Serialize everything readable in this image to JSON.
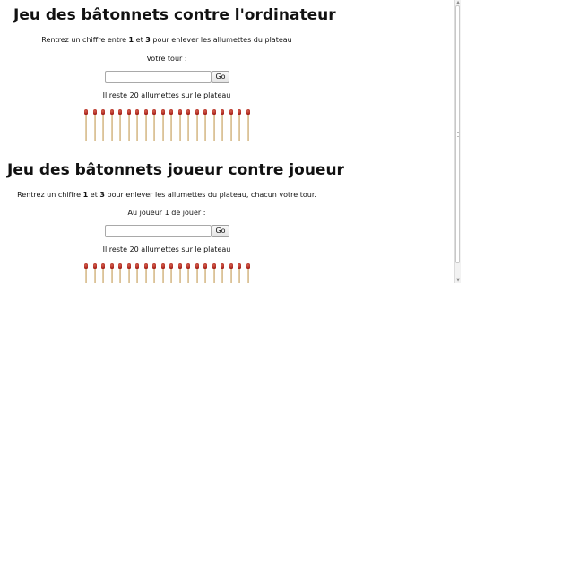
{
  "games": [
    {
      "title": "Jeu des bâtonnets contre l'ordinateur",
      "instruction": {
        "before": "Rentrez un chiffre entre ",
        "min": "1",
        "between": " et ",
        "max": "3",
        "after": " pour enlever les allumettes du plateau"
      },
      "turn_text": "Votre tour :",
      "input": {
        "value": "",
        "placeholder": ""
      },
      "go_label": "Go",
      "remaining_text": "Il reste 20 allumettes sur le plateau",
      "matches_count": 20
    },
    {
      "title": "Jeu des bâtonnets joueur contre joueur",
      "instruction": {
        "before": "Rentrez un chiffre ",
        "min": "1",
        "between": " et ",
        "max": "3",
        "after": " pour enlever les allumettes du plateau, chacun votre tour."
      },
      "turn_text": "Au joueur 1 de jouer :",
      "input": {
        "value": "",
        "placeholder": ""
      },
      "go_label": "Go",
      "remaining_text": "Il reste 20 allumettes sur le plateau",
      "matches_count": 20
    }
  ],
  "colors": {
    "match_head": "#a8231c",
    "match_stick": "#e0cca4",
    "divider": "#d8d8d8"
  },
  "icons": {
    "scroll_up": "scroll-up-arrow-icon",
    "scroll_down": "scroll-down-arrow-icon",
    "match": "match-icon"
  }
}
